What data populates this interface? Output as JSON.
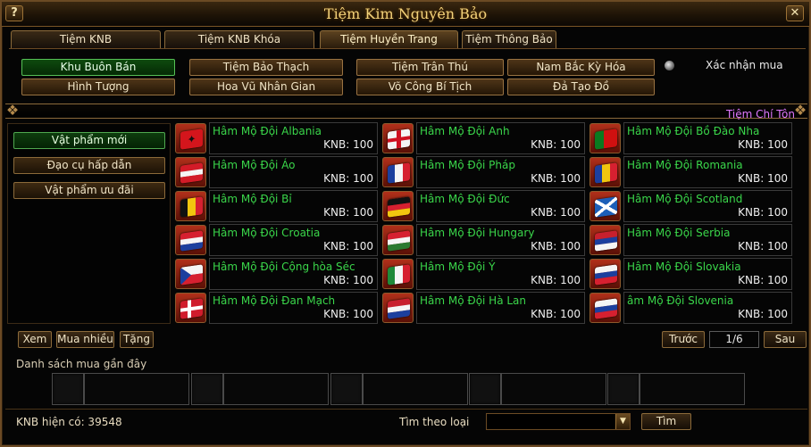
{
  "window": {
    "title": "Tiệm Kim Nguyên Bảo",
    "help_icon": "question-icon",
    "close_icon": "close-icon"
  },
  "tabs": [
    {
      "label": "Tiệm KNB"
    },
    {
      "label": "Tiệm KNB Khóa"
    },
    {
      "label": "Tiệm Huyền Trang"
    },
    {
      "label": "Tiệm Thông Bảo"
    }
  ],
  "submenu": {
    "row1": [
      "Khu Buôn Bán",
      "Tiệm Bảo Thạch",
      "Tiệm Trân Thú",
      "Nam Bắc Kỳ Hóa"
    ],
    "row2": [
      "Hình Tượng",
      "Hoa Vũ Nhân Gian",
      "Võ Công Bí Tịch",
      "Đả Tạo Đồ"
    ],
    "confirm_label": "Xác nhận mua"
  },
  "exclusive_label": "Tiệm Chí Tôn",
  "categories": [
    "Vật phẩm mới",
    "Đạo cụ hấp dẫn",
    "Vật phẩm ưu đãi"
  ],
  "items": [
    {
      "name": "Hâm Mộ Đội Albania",
      "price": "KNB: 100",
      "flag": "albania-flag-icon"
    },
    {
      "name": "Hâm Mộ Đội Anh",
      "price": "KNB: 100",
      "flag": "england-flag-icon"
    },
    {
      "name": "Hâm Mộ Đội Bồ Đào Nha",
      "price": "KNB: 100",
      "flag": "portugal-flag-icon"
    },
    {
      "name": "Hâm Mộ Đội Áo",
      "price": "KNB: 100",
      "flag": "austria-flag-icon"
    },
    {
      "name": "Hâm Mộ Đội Pháp",
      "price": "KNB: 100",
      "flag": "france-flag-icon"
    },
    {
      "name": "Hâm Mộ Đội Romania",
      "price": "KNB: 100",
      "flag": "romania-flag-icon"
    },
    {
      "name": "Hâm Mộ Đội Bỉ",
      "price": "KNB: 100",
      "flag": "belgium-flag-icon"
    },
    {
      "name": "Hâm Mộ Đội Đức",
      "price": "KNB: 100",
      "flag": "germany-flag-icon"
    },
    {
      "name": "Hâm Mộ Đội Scotland",
      "price": "KNB: 100",
      "flag": "scotland-flag-icon"
    },
    {
      "name": "Hâm Mộ Đội Croatia",
      "price": "KNB: 100",
      "flag": "croatia-flag-icon"
    },
    {
      "name": "Hâm Mộ Đội Hungary",
      "price": "KNB: 100",
      "flag": "hungary-flag-icon"
    },
    {
      "name": "Hâm Mộ Đội Serbia",
      "price": "KNB: 100",
      "flag": "serbia-flag-icon"
    },
    {
      "name": "Hâm Mộ Đội Cộng hòa Séc",
      "price": "KNB: 100",
      "flag": "czech-flag-icon"
    },
    {
      "name": "Hâm Mộ Đội Ý",
      "price": "KNB: 100",
      "flag": "italy-flag-icon"
    },
    {
      "name": "Hâm Mộ Đội Slovakia",
      "price": "KNB: 100",
      "flag": "slovakia-flag-icon"
    },
    {
      "name": "Hâm Mộ Đội Đan Mạch",
      "price": "KNB: 100",
      "flag": "denmark-flag-icon"
    },
    {
      "name": "Hâm Mộ Đội Hà Lan",
      "price": "KNB: 100",
      "flag": "netherlands-flag-icon"
    },
    {
      "name": "âm Mộ Đội Slovenia",
      "price": "KNB: 100",
      "flag": "slovenia-flag-icon"
    }
  ],
  "actions": {
    "view": "Xem",
    "buy_many": "Mua nhiều",
    "gift": "Tặng"
  },
  "pagination": {
    "prev": "Trước",
    "page": "1/6",
    "next": "Sau"
  },
  "recent": {
    "label": "Danh sách mua gần đây"
  },
  "footer": {
    "balance": "KNB hiện có: 39548",
    "search_label": "Tìm theo loại",
    "search_button": "Tìm",
    "dropdown_icon": "chevron-down-icon"
  }
}
